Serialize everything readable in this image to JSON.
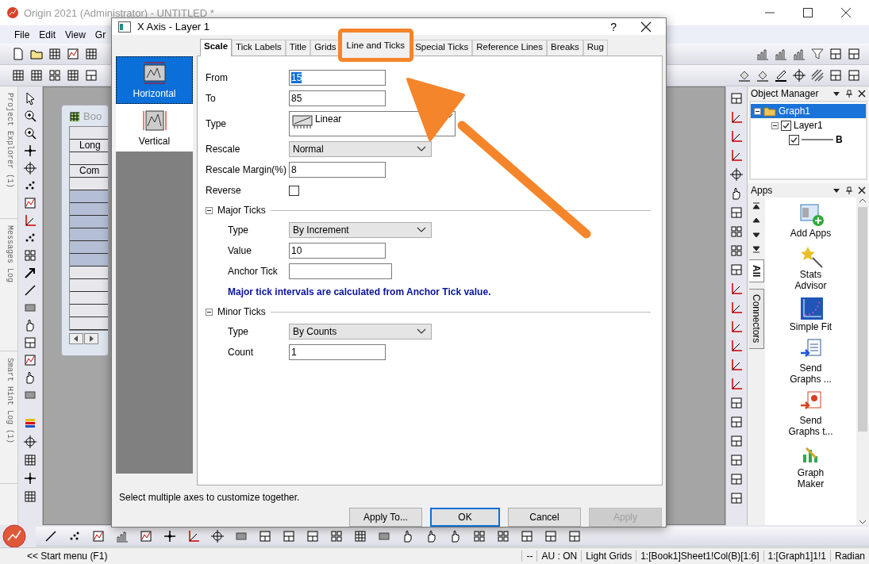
{
  "app": {
    "title": "Origin 2021 (Administrator) - UNTITLED *"
  },
  "menu": [
    "File",
    "Edit",
    "View",
    "Gr"
  ],
  "side_tabs": [
    "Project Explorer (1)",
    "Messages Log",
    "Smart Hint Log (1)"
  ],
  "workbook": {
    "title": "Boo",
    "labels": [
      "Long",
      "Com"
    ]
  },
  "dialog": {
    "title": "X Axis - Layer 1",
    "help": "?",
    "axes": [
      {
        "label": "Horizontal",
        "selected": true
      },
      {
        "label": "Vertical",
        "selected": false
      }
    ],
    "tabs": [
      {
        "label": "Scale",
        "selected": true
      },
      {
        "label": "Tick Labels",
        "selected": false
      },
      {
        "label": "Title",
        "selected": false
      },
      {
        "label": "Grids",
        "selected": false
      },
      {
        "label": "Line and Ticks",
        "selected": false,
        "highlighted": true
      },
      {
        "label": "Special Ticks",
        "selected": false
      },
      {
        "label": "Reference Lines",
        "selected": false
      },
      {
        "label": "Breaks",
        "selected": false
      },
      {
        "label": "Rug",
        "selected": false
      }
    ],
    "fields": [
      {
        "kind": "input",
        "label": "From",
        "value": "15",
        "focused": true
      },
      {
        "kind": "input",
        "label": "To",
        "value": "85",
        "focused": false
      },
      {
        "kind": "scale",
        "label": "Type",
        "value": "Linear"
      },
      {
        "kind": "select",
        "label": "Rescale",
        "value": "Normal"
      },
      {
        "kind": "input",
        "label": "Rescale Margin(%)",
        "value": "8",
        "focused": false
      },
      {
        "kind": "checkbox",
        "label": "Reverse",
        "checked": false
      }
    ],
    "sections": [
      {
        "title": "Major Ticks",
        "expanded": true,
        "fields": [
          {
            "kind": "select",
            "label": "Type",
            "value": "By Increment"
          },
          {
            "kind": "input",
            "label": "Value",
            "value": "10",
            "focused": false
          },
          {
            "kind": "input",
            "label": "Anchor Tick",
            "focused": false
          }
        ],
        "note": "Major tick intervals are calculated from Anchor Tick value."
      },
      {
        "title": "Minor Ticks",
        "expanded": true,
        "fields": [
          {
            "kind": "select",
            "label": "Type",
            "value": "By Counts"
          },
          {
            "kind": "input",
            "label": "Count",
            "value": "1",
            "focused": false
          }
        ]
      }
    ],
    "hint": "Select multiple axes to customize together.",
    "buttons": [
      {
        "label": "Apply To...",
        "default": false,
        "disabled": false
      },
      {
        "label": "OK",
        "default": true,
        "disabled": false
      },
      {
        "label": "Cancel",
        "default": false,
        "disabled": false
      },
      {
        "label": "Apply",
        "default": false,
        "disabled": true
      }
    ]
  },
  "object_manager": {
    "title": "Object Manager",
    "tree": [
      {
        "label": "Graph1",
        "selected": true,
        "expanded": true,
        "children": [
          {
            "label": "Layer1",
            "checked": true,
            "expanded": true,
            "children": [
              {
                "label": "B",
                "checked": true
              }
            ]
          }
        ]
      }
    ]
  },
  "apps": {
    "title": "Apps",
    "tabs": [
      {
        "label": "All",
        "selected": true
      },
      {
        "label": "Connectors",
        "selected": false
      }
    ],
    "items": [
      "Add Apps",
      "Stats Advisor",
      "Simple Fit",
      "Send Graphs ...",
      "Send Graphs t...",
      "Graph Maker"
    ]
  },
  "start_menu": "<< Start menu (F1)",
  "status_bar": [
    "--",
    "AU : ON",
    "Light Grids",
    "1:[Book1]Sheet1!Col(B)[1:6]",
    "1:[Graph1]1!1",
    "Radian"
  ]
}
